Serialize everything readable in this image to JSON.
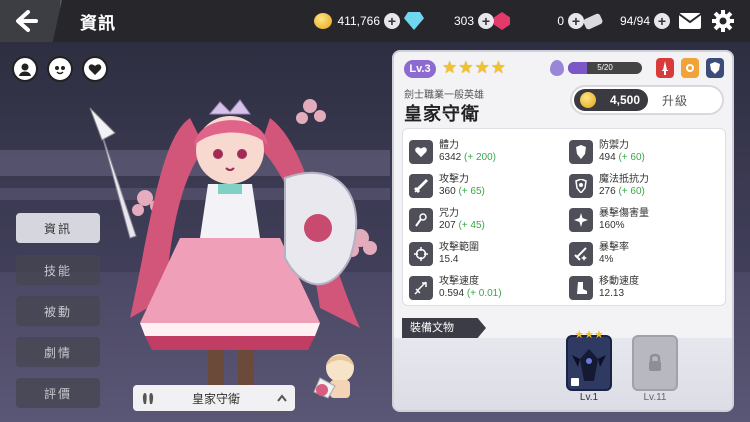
{
  "header": {
    "title": "資訊",
    "gold": "411,766",
    "gems": "303",
    "rubies": "0",
    "stamina": "94/94"
  },
  "quick_icons": [
    "profile-icon",
    "face-icon",
    "heart-icon"
  ],
  "menu": {
    "items": [
      {
        "label": "資訊",
        "active": true
      },
      {
        "label": "技能",
        "active": false
      },
      {
        "label": "被動",
        "active": false
      },
      {
        "label": "劇情",
        "active": false
      },
      {
        "label": "評價",
        "active": false
      }
    ]
  },
  "nameplate": {
    "name": "皇家守衛"
  },
  "hero": {
    "level": "Lv.3",
    "stars": 4,
    "exp_text": "5/20",
    "exp_fraction": 0.25,
    "class_line": "劍士職業一般英雄",
    "name": "皇家守衛",
    "upgrade_cost": "4,500",
    "upgrade_label": "升級",
    "emblem_colors": [
      "#d93a3a",
      "#f0a336",
      "#3c4b7a"
    ]
  },
  "stats": [
    {
      "label": "體力",
      "value": "6342",
      "bonus": "(+ 200)",
      "icon": "heart-icon"
    },
    {
      "label": "防禦力",
      "value": "494",
      "bonus": "(+ 60)",
      "icon": "shield-icon"
    },
    {
      "label": "攻擊力",
      "value": "360",
      "bonus": "(+ 65)",
      "icon": "sword-icon"
    },
    {
      "label": "魔法抵抗力",
      "value": "276",
      "bonus": "(+ 60)",
      "icon": "magic-shield-icon"
    },
    {
      "label": "咒力",
      "value": "207",
      "bonus": "(+ 45)",
      "icon": "staff-icon"
    },
    {
      "label": "暴擊傷害量",
      "value": "160%",
      "bonus": "",
      "icon": "crit-damage-icon"
    },
    {
      "label": "攻擊範圍",
      "value": "15.4",
      "bonus": "",
      "icon": "crosshair-icon"
    },
    {
      "label": "暴擊率",
      "value": "4%",
      "bonus": "",
      "icon": "crit-rate-icon"
    },
    {
      "label": "攻擊速度",
      "value": "0.594",
      "bonus": "(+ 0.01)",
      "icon": "attack-speed-icon"
    },
    {
      "label": "移動速度",
      "value": "12.13",
      "bonus": "",
      "icon": "boot-icon"
    }
  ],
  "equipment": {
    "title": "裝備文物",
    "slots": [
      {
        "level": "Lv.1",
        "locked": false,
        "stars": 3
      },
      {
        "level": "Lv.11",
        "locked": true
      }
    ]
  },
  "colors": {
    "accent_purple": "#8c6bd1",
    "bonus_green": "#3aa64b",
    "star_gold": "#f3c22a"
  }
}
